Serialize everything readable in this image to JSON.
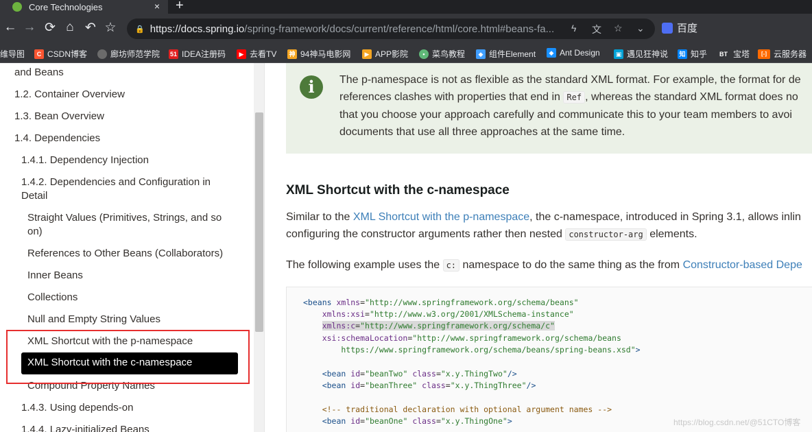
{
  "browser": {
    "tab_title": "Core Technologies",
    "tab_close": "×",
    "new_tab": "+",
    "url_host": "https://docs.spring.io",
    "url_path": "/spring-framework/docs/current/reference/html/core.html#beans-fa...",
    "profile_label": "百度"
  },
  "bookmarks": [
    {
      "label": "维导图",
      "color": "#35363a"
    },
    {
      "label": "CSDN博客",
      "color": "#fc5531",
      "glyph": "C"
    },
    {
      "label": "廊坊师范学院",
      "color": "#6b6b6b",
      "glyph": ""
    },
    {
      "label": "IDEA注册码",
      "color": "#e02020",
      "glyph": "51"
    },
    {
      "label": "去看TV",
      "color": "#ff0000",
      "glyph": "▶"
    },
    {
      "label": "94神马电影网",
      "color": "#f5a623",
      "glyph": "神"
    },
    {
      "label": "APP影院",
      "color": "#f5a623",
      "glyph": "▶"
    },
    {
      "label": "菜鸟教程",
      "color": "#5fb878",
      "glyph": "•"
    },
    {
      "label": "组件Element",
      "color": "#409eff",
      "glyph": "◆"
    },
    {
      "label": "Ant Design",
      "color": "#1890ff",
      "glyph": "◆"
    },
    {
      "label": "遇见狂神说",
      "color": "#00a1d6",
      "glyph": "▣"
    },
    {
      "label": "知乎",
      "color": "#0084ff",
      "glyph": "知"
    },
    {
      "label": "宝塔",
      "color": "#35363a",
      "glyph": "BT"
    },
    {
      "label": "云服务器",
      "color": "#ff6a00",
      "glyph": "[-]"
    }
  ],
  "sidebar": {
    "items": [
      {
        "label": "and Beans"
      },
      {
        "label": "1.2. Container Overview"
      },
      {
        "label": "1.3. Bean Overview"
      },
      {
        "label": "1.4. Dependencies"
      },
      {
        "label": "1.4.1. Dependency Injection"
      },
      {
        "label": "1.4.2. Dependencies and Configuration in"
      },
      {
        "label": "Detail"
      },
      {
        "label": "Straight Values (Primitives, Strings, and so"
      },
      {
        "label": "on)"
      },
      {
        "label": "References to Other Beans (Collaborators)"
      },
      {
        "label": "Inner Beans"
      },
      {
        "label": "Collections"
      },
      {
        "label": "Null and Empty String Values"
      },
      {
        "label": "XML Shortcut with the p-namespace"
      },
      {
        "label": "XML Shortcut with the c-namespace"
      },
      {
        "label": "Compound Property Names"
      },
      {
        "label": "1.4.3. Using depends-on"
      },
      {
        "label": "1.4.4. Lazy-initialized Beans"
      }
    ]
  },
  "content": {
    "note_line1": "The p-namespace is not as flexible as the standard XML format. For example, the format for de",
    "note_line2a": "references clashes with properties that end in",
    "note_code": "Ref",
    "note_line2b": ", whereas the standard XML format does no",
    "note_line3": "that you choose your approach carefully and communicate this to your team members to avoi",
    "note_line4": "documents that use all three approaches at the same time.",
    "section_title": "XML Shortcut with the c-namespace",
    "para1_a": "Similar to the",
    "para1_link": "XML Shortcut with the p-namespace",
    "para1_b": ", the c-namespace, introduced in Spring 3.1, allows inlin",
    "para2_a": "configuring the constructor arguments rather then nested",
    "para2_code": "constructor-arg",
    "para2_b": "elements.",
    "para3_a": "The following example uses the",
    "para3_code": "c:",
    "para3_b": "namespace to do the same thing as the from",
    "para3_link": "Constructor-based Depe",
    "watermark": "https://blog.csdn.net/@51CTO博客"
  }
}
